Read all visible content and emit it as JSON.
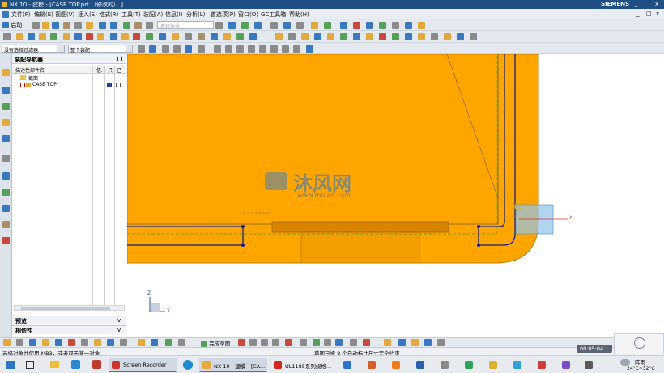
{
  "window": {
    "title": "NX 10 - 建模 - [CASE TOP.prt （修改的） ]",
    "brand": "SIEMENS",
    "controls": [
      "_",
      "□",
      "x"
    ],
    "doc_controls": [
      "_",
      "□",
      "x"
    ]
  },
  "menu": {
    "start": "启动",
    "items": [
      "文件(F)",
      "编辑(E)",
      "视图(V)",
      "插入(S)",
      "格式(R)",
      "工具(T)",
      "装配(A)",
      "信息(I)",
      "分析(L)",
      "首选项(P)",
      "窗口(O)",
      "GC工具箱",
      "帮助(H)"
    ]
  },
  "toolbar": {
    "search_placeholder": "查找命令"
  },
  "selection": {
    "filter": "没有选择过滤器",
    "scope": "整个装配"
  },
  "navigator": {
    "title": "装配导航器",
    "columns": [
      "描述性部件名",
      "信.",
      "只",
      "已"
    ],
    "items": [
      {
        "label": "截面",
        "indent": 1
      },
      {
        "label": "CASE TOP",
        "indent": 1
      }
    ],
    "panels": [
      "预览",
      "相依性"
    ]
  },
  "watermark": {
    "text": "沐风网",
    "url": "www.mfcad.com"
  },
  "csys": {
    "x": "X",
    "y": "Y",
    "z": "Z"
  },
  "finish_sketch": "完成草图",
  "status": {
    "prompt": "选择对象并使用 MB3，或者双击某一对象",
    "sketch": "草图已被 8 个自动标注尺寸完全约束",
    "time": "00:05:04"
  },
  "taskbar": {
    "apps": [
      "Screen Recorder",
      "NX 10 - 建模 - [CA...",
      "UL1185系列规格..."
    ],
    "weather": {
      "condition": "阵雨",
      "temp": "24°C~32°C"
    }
  },
  "colors": {
    "part": "#FFA500",
    "sketch": "#1a1f7a",
    "title": "#1f4f85",
    "handle": "#8fc3ea"
  }
}
